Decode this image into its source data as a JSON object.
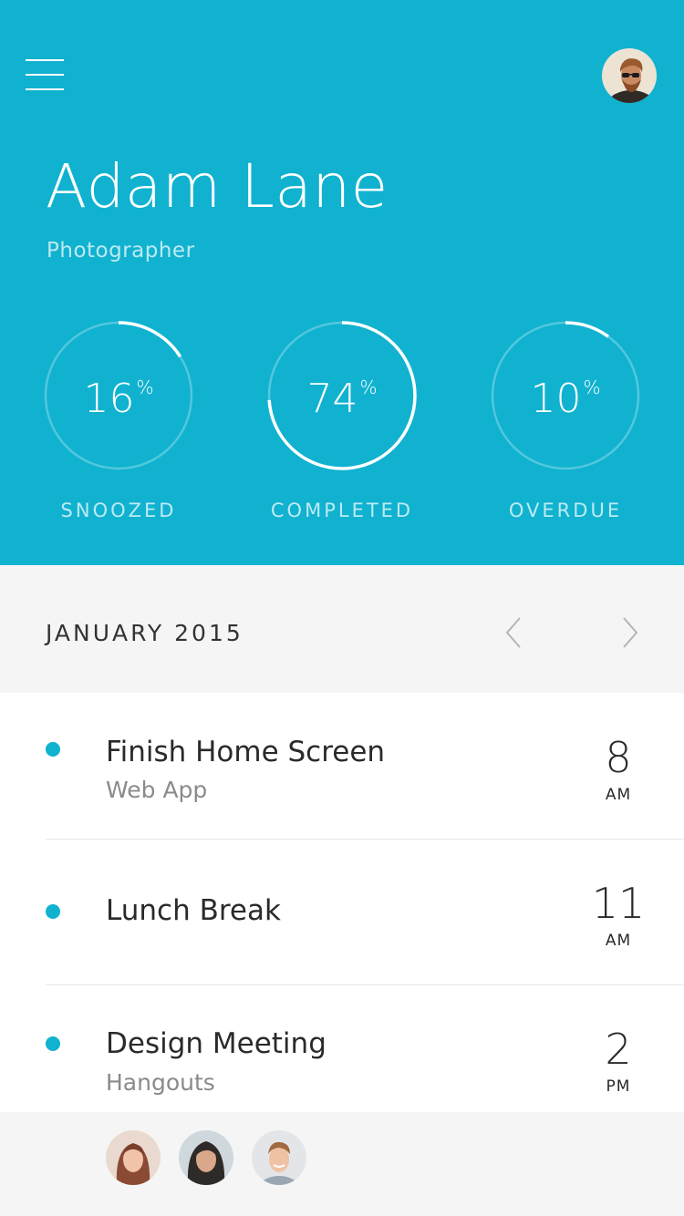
{
  "profile": {
    "name": "Adam Lane",
    "role": "Photographer"
  },
  "stats": [
    {
      "value": "16",
      "percent": 16,
      "sign": "%",
      "label": "SNOOZED"
    },
    {
      "value": "74",
      "percent": 74,
      "sign": "%",
      "label": "COMPLETED"
    },
    {
      "value": "10",
      "percent": 10,
      "sign": "%",
      "label": "OVERDUE"
    }
  ],
  "calendar": {
    "month": "JANUARY 2015"
  },
  "events": [
    {
      "title": "Finish Home Screen",
      "subtitle": "Web App",
      "hour": "8",
      "period": "AM"
    },
    {
      "title": "Lunch Break",
      "subtitle": "",
      "hour": "11",
      "period": "AM"
    },
    {
      "title": "Design Meeting",
      "subtitle": "Hangouts",
      "hour": "2",
      "period": "PM"
    }
  ],
  "icons": {
    "menu": "menu-icon",
    "prev": "chevron-left-icon",
    "next": "chevron-right-icon"
  },
  "colors": {
    "accent": "#10b2d0",
    "background": "#f5f5f5",
    "card": "#ffffff",
    "text_primary": "#2a2a2a",
    "text_secondary": "#8a8a8a"
  }
}
